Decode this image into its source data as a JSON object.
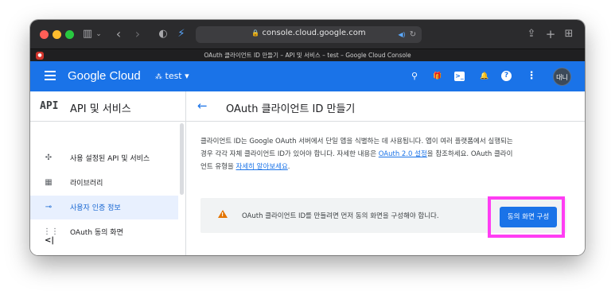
{
  "browser": {
    "url": "console.cloud.google.com",
    "tab_title": "OAuth 클라이언트 ID 만들기 – API 및 서비스 – test – Google Cloud Console",
    "tab_badge": "●",
    "icons": [
      "sidebar-toggle-icon",
      "back-icon",
      "forward-icon",
      "privacy-shield-icon",
      "extension-icon",
      "lock-icon",
      "audio-icon",
      "reload-icon",
      "share-icon",
      "new-tab-icon",
      "tab-overview-icon"
    ],
    "glyphs": {
      "sidebar": "▥",
      "chevron": "⌄",
      "back": "‹",
      "forward": "›",
      "shield": "◐",
      "ext": "⚡",
      "lock": "🔒",
      "audio": "◀)",
      "reload": "↻",
      "share": "⇪",
      "plus": "+",
      "grid": "⊞"
    }
  },
  "header": {
    "logo": "Google Cloud",
    "project": "test ▾",
    "avatar": "대니",
    "icon_glyphs": {
      "search": "⚲",
      "gift": "🎁",
      "terminal": ">_",
      "bell": "🔔",
      "help": "?",
      "more": "⋮"
    }
  },
  "sidebar": {
    "api_mark": "API",
    "title": "API 및 서비스",
    "items": [
      {
        "label": "사용 설정된 API 및 서비스",
        "icon": "✣"
      },
      {
        "label": "라이브러리",
        "icon": "▦"
      },
      {
        "label": "사용자 인증 정보",
        "icon": "⊸"
      },
      {
        "label": "OAuth 동의 화면",
        "icon": "⋮⋮"
      }
    ],
    "collapse": "<|"
  },
  "main": {
    "back_arrow": "←",
    "title": "OAuth 클라이언트 ID 만들기",
    "desc_part1": "클라이언트 ID는 Google OAuth 서버에서 단일 앱을 식별하는 데 사용됩니다. 앱이 여러 플랫폼에서 실행되는 경우 각각 자체 클라이언트 ID가 있어야 합니다. 자세한 내용은 ",
    "desc_link1": "OAuth 2.0 설정",
    "desc_part2": "을 참조하세요. OAuth 클라이언트 유형을 ",
    "desc_link2": "자세히 알아보세요",
    "desc_part3": ".",
    "banner_text": "OAuth 클라이언트 ID를 만들려면 먼저 동의 화면을 구성해야 합니다.",
    "warn_mark": "!",
    "cta": "동의 화면 구성"
  },
  "colors": {
    "accent": "#1a73e8",
    "highlight": "#ff3df3",
    "warning": "#e37400"
  }
}
